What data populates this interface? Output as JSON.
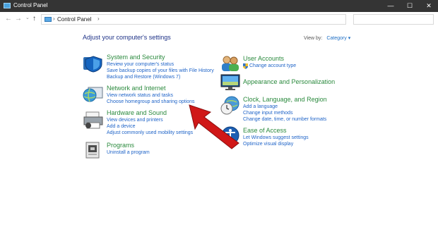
{
  "window": {
    "title": "Control Panel",
    "minimize": "—",
    "maximize": "☐",
    "close": "✕"
  },
  "nav": {
    "back": "←",
    "forward": "→",
    "dropdown": "⌄",
    "up": "↑"
  },
  "address": {
    "sep1": "›",
    "crumb": "Control Panel",
    "sep2": "›"
  },
  "search": {
    "placeholder": ""
  },
  "main": {
    "heading": "Adjust your computer's settings",
    "view_by_label": "View by:",
    "view_by_value": "Category ▾",
    "left": [
      {
        "title": "System and Security",
        "links": [
          "Review your computer's status",
          "Save backup copies of your files with File History",
          "Backup and Restore (Windows 7)"
        ],
        "icon": "shield-icon"
      },
      {
        "title": "Network and Internet",
        "links": [
          "View network status and tasks",
          "Choose homegroup and sharing options"
        ],
        "icon": "globe-icon"
      },
      {
        "title": "Hardware and Sound",
        "links": [
          "View devices and printers",
          "Add a device",
          "Adjust commonly used mobility settings"
        ],
        "icon": "printer-icon"
      },
      {
        "title": "Programs",
        "links": [
          "Uninstall a program"
        ],
        "icon": "programs-icon"
      }
    ],
    "right": [
      {
        "title": "User Accounts",
        "links": [
          "Change account type"
        ],
        "icon": "users-icon"
      },
      {
        "title": "Appearance and Personalization",
        "links": [],
        "icon": "monitor-icon"
      },
      {
        "title": "Clock, Language, and Region",
        "links": [
          "Add a language",
          "Change input methods",
          "Change date, time, or number formats"
        ],
        "icon": "clock-icon"
      },
      {
        "title": "Ease of Access",
        "links": [
          "Let Windows suggest settings",
          "Optimize visual display"
        ],
        "icon": "accessibility-icon"
      }
    ]
  },
  "colors": {
    "titlebar": "#343434",
    "category_title": "#2b8a3e",
    "link": "#1f64c8",
    "heading": "#1e3287",
    "annotation_arrow": "#d01818"
  }
}
